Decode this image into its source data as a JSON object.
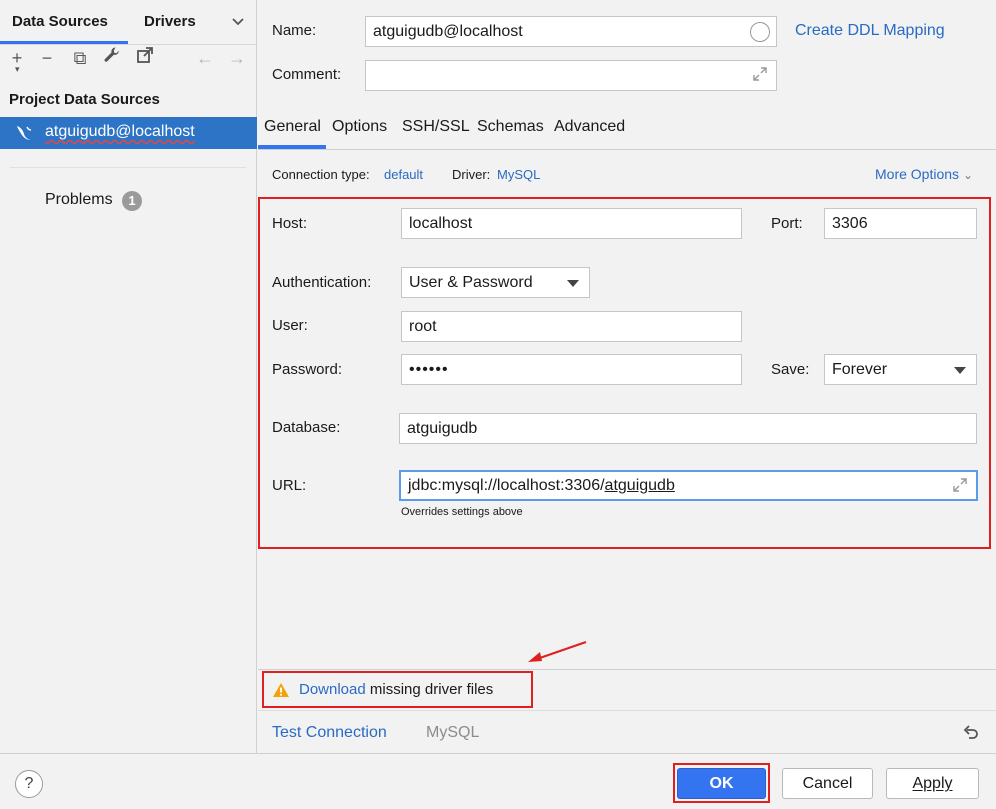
{
  "left": {
    "tabs": [
      "Data Sources",
      "Drivers"
    ],
    "toolbar": [
      {
        "icon": "plus-icon",
        "glyph": "+"
      },
      {
        "icon": "minus-icon",
        "glyph": "−"
      },
      {
        "icon": "duplicate-icon",
        "glyph": "⧉"
      },
      {
        "icon": "wrench-icon",
        "glyph": "🔧"
      },
      {
        "icon": "jump-icon",
        "glyph": "↗"
      },
      {
        "icon": "back-arrow-icon",
        "glyph": "←"
      },
      {
        "icon": "forward-arrow-icon",
        "glyph": "→"
      }
    ],
    "section_title": "Project Data Sources",
    "datasource": "atguigudb@localhost",
    "problems_label": "Problems",
    "problems_count": "1"
  },
  "form": {
    "name_label": "Name:",
    "name_value": "atguigudb@localhost",
    "create_ddl": "Create DDL Mapping",
    "comment_label": "Comment:",
    "comment_value": ""
  },
  "tabs": [
    "General",
    "Options",
    "SSH/SSL",
    "Schemas",
    "Advanced"
  ],
  "active_tab": "General",
  "connection": {
    "type_label": "Connection type:",
    "type_value": "default",
    "driver_label": "Driver:",
    "driver_value": "MySQL",
    "more_options": "More Options"
  },
  "general": {
    "host_label": "Host:",
    "host_value": "localhost",
    "port_label": "Port:",
    "port_value": "3306",
    "auth_label": "Authentication:",
    "auth_value": "User & Password",
    "user_label": "User:",
    "user_value": "root",
    "password_label": "Password:",
    "password_value": "••••••",
    "save_label": "Save:",
    "save_value": "Forever",
    "database_label": "Database:",
    "database_value": "atguigudb",
    "url_label": "URL:",
    "url_prefix": "jdbc:mysql://localhost:3306/",
    "url_db": "atguigudb",
    "url_hint": "Overrides settings above"
  },
  "warning": {
    "link": "Download",
    "text": " missing driver files"
  },
  "bottom": {
    "test_connection": "Test Connection",
    "driver_name": "MySQL"
  },
  "footer": {
    "help": "?",
    "ok": "OK",
    "cancel": "Cancel",
    "apply": "Apply"
  },
  "colors": {
    "accent": "#3574f0",
    "link": "#2a6ac3",
    "selection": "#2d74c7",
    "highlight_box": "#e02020",
    "warning": "#f0a30a"
  }
}
